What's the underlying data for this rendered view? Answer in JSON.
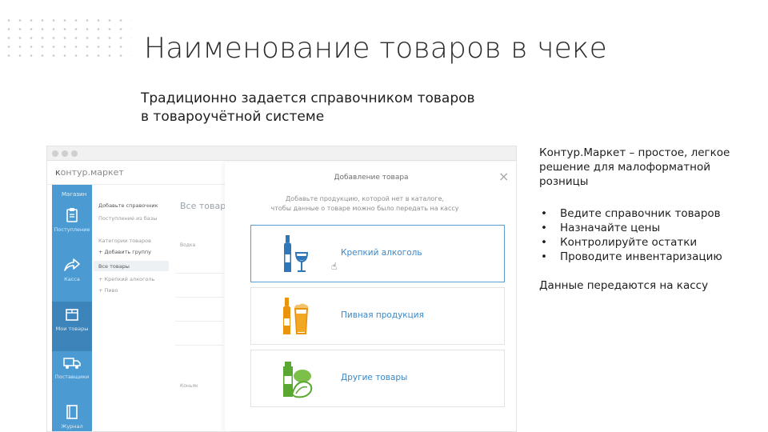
{
  "slide": {
    "title": "Наименование товаров в чеке",
    "subtitle_line1": "Традиционно задается справочником товаров",
    "subtitle_line2": "в товароучётной системе"
  },
  "aside": {
    "lead_line1": "Контур.Маркет – простое, легкое",
    "lead_line2": "решение для малоформатной",
    "lead_line3": "розницы",
    "bullets": [
      "Ведите справочник товаров",
      "Назначайте цены",
      "Контролируйте остатки",
      "Проводите инвентаризацию"
    ],
    "footer": "Данные передаются на кассу"
  },
  "app": {
    "logo_prefix": "к",
    "logo_rest": "онтур.маркет",
    "sidebar": {
      "top": "Магазин",
      "items": [
        {
          "label": "Поступление",
          "icon": "clipboard-icon"
        },
        {
          "label": "Касса",
          "icon": "arrow-icon"
        },
        {
          "label": "Мои товары",
          "icon": "box-icon"
        },
        {
          "label": "Поставщики",
          "icon": "truck-icon"
        },
        {
          "label": "Журнал инвентаризации",
          "icon": "journal-icon"
        }
      ]
    },
    "mid": {
      "line1": "Добавьте справочник",
      "line2": "Поступление из базы",
      "section": "Категории товаров",
      "add_group": "+ Добавить группу",
      "active": "Все товары",
      "sub1": "+ Крепкий алкоголь",
      "sub2": "+ Пиво"
    },
    "list": {
      "title": "Все товары",
      "group1": "Водка",
      "group2": "Коньяк"
    }
  },
  "modal": {
    "title": "Добавление товара",
    "close": "×",
    "desc_line1": "Добавьте продукцию, которой нет в каталоге,",
    "desc_line2": "чтобы данные о товаре можно было передать на кассу",
    "options": [
      {
        "label": "Крепкий алкоголь",
        "icon": "liquor-bottle-icon",
        "selected": true
      },
      {
        "label": "Пивная продукция",
        "icon": "beer-icon",
        "selected": false
      },
      {
        "label": "Другие товары",
        "icon": "groceries-icon",
        "selected": false
      }
    ]
  },
  "colors": {
    "sidebar": "#4b9ad1",
    "sidebar_active": "#3c84b9",
    "link": "#3a87c7",
    "selected_border": "#5c9fd6"
  }
}
